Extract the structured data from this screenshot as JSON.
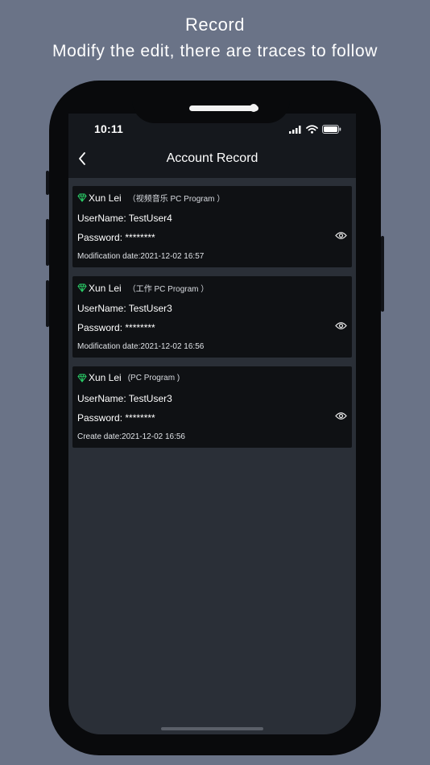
{
  "promo": {
    "title": "Record",
    "subtitle": "Modify the edit, there are traces to follow"
  },
  "status_bar": {
    "time": "10:11",
    "icons": [
      "signal-icon",
      "wifi-icon",
      "battery-icon"
    ]
  },
  "nav": {
    "title": "Account Record",
    "back_icon": "chevron-left-icon"
  },
  "records": [
    {
      "name": "Xun Lei",
      "category": "（视频音乐  PC Program ）",
      "username": "UserName: TestUser4",
      "password": "Password: ********",
      "date": "Modification date:2021-12-02 16:57"
    },
    {
      "name": "Xun Lei",
      "category": "（工作  PC Program ）",
      "username": "UserName: TestUser3",
      "password": "Password: ********",
      "date": "Modification date:2021-12-02 16:56"
    },
    {
      "name": "Xun Lei",
      "category": "(PC Program )",
      "username": "UserName: TestUser3",
      "password": "Password: ********",
      "date": "Create date:2021-12-02 16:56"
    }
  ],
  "colors": {
    "background": "#6a7387",
    "screen": "#2a2f37",
    "card": "#0f1114",
    "diamond": "#2bd46a"
  }
}
